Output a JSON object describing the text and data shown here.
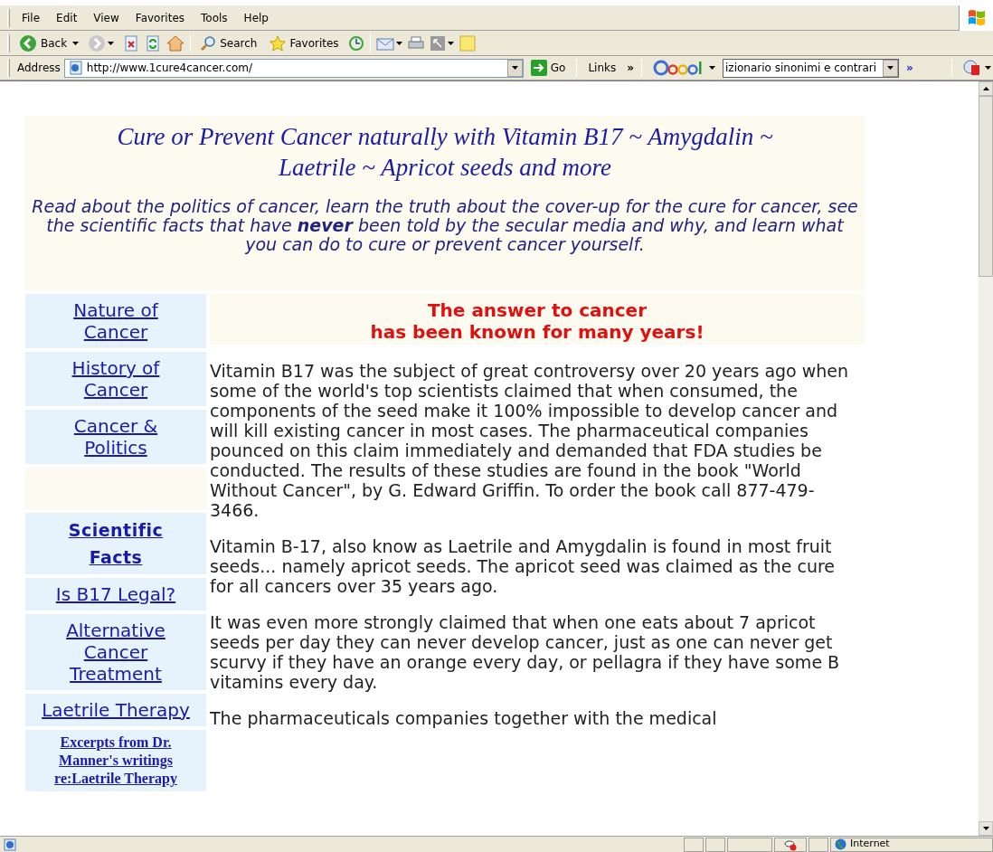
{
  "menu": [
    "File",
    "Edit",
    "View",
    "Favorites",
    "Tools",
    "Help"
  ],
  "toolbar": {
    "back": "Back",
    "search": "Search",
    "favorites": "Favorites"
  },
  "address_bar": {
    "label": "Address",
    "url": "http://www.1cure4cancer.com/",
    "go": "Go",
    "links": "Links",
    "links_more": "»",
    "google_query": "izionario sinonimi e contrari",
    "google_more": "»"
  },
  "page": {
    "title": "Cure or Prevent Cancer naturally with Vitamin B17 ~ Amygdalin ~ Laetrile ~ Apricot seeds and more",
    "subtitle": "Read about the politics of cancer, learn the truth about the cover-up for the cure for cancer, see the scientific facts that have **never** been told by the secular media and why, and learn what you can do to cure or prevent cancer yourself.",
    "nav": [
      {
        "kind": "normal",
        "label": "Nature of Cancer"
      },
      {
        "kind": "normal",
        "label": "History of Cancer"
      },
      {
        "kind": "normal",
        "label": "Cancer & Politics"
      },
      {
        "kind": "bold",
        "label": "Scientific Facts"
      },
      {
        "kind": "normal",
        "label": "Is B17 Legal?"
      },
      {
        "kind": "normal",
        "label": "Alternative Cancer Treatment"
      },
      {
        "kind": "plain",
        "label": "Laetrile Therapy"
      },
      {
        "kind": "serif",
        "label": "Excerpts from Dr. Manner's writings re:Laetrile Therapy"
      }
    ],
    "headline": [
      "The answer to cancer",
      "has been known for many years!"
    ],
    "paragraphs": [
      "Vitamin B17 was the subject of great controversy over 20 years ago when some of the world's top scientists claimed that when consumed, the components of the seed make it 100% impossible to develop cancer and will kill existing cancer in most cases. The pharmaceutical companies pounced on this claim immediately and demanded that FDA studies be conducted. The results of these studies are found in the book \"World Without Cancer\", by G. Edward Griffin. To order the book call 877-479-3466.",
      "Vitamin B-17, also know as Laetrile and Amygdalin is found in most fruit seeds... namely apricot seeds. The apricot seed was claimed as the cure for all cancers over 35 years ago.",
      "It was even more strongly claimed that when one eats about 7 apricot seeds per day they can never develop cancer, just as one can never get scurvy if they have an orange every day, or pellagra if they have some B vitamins every day.",
      "The pharmaceuticals companies together with the medical"
    ]
  },
  "status_bar": {
    "zone": "Internet"
  }
}
